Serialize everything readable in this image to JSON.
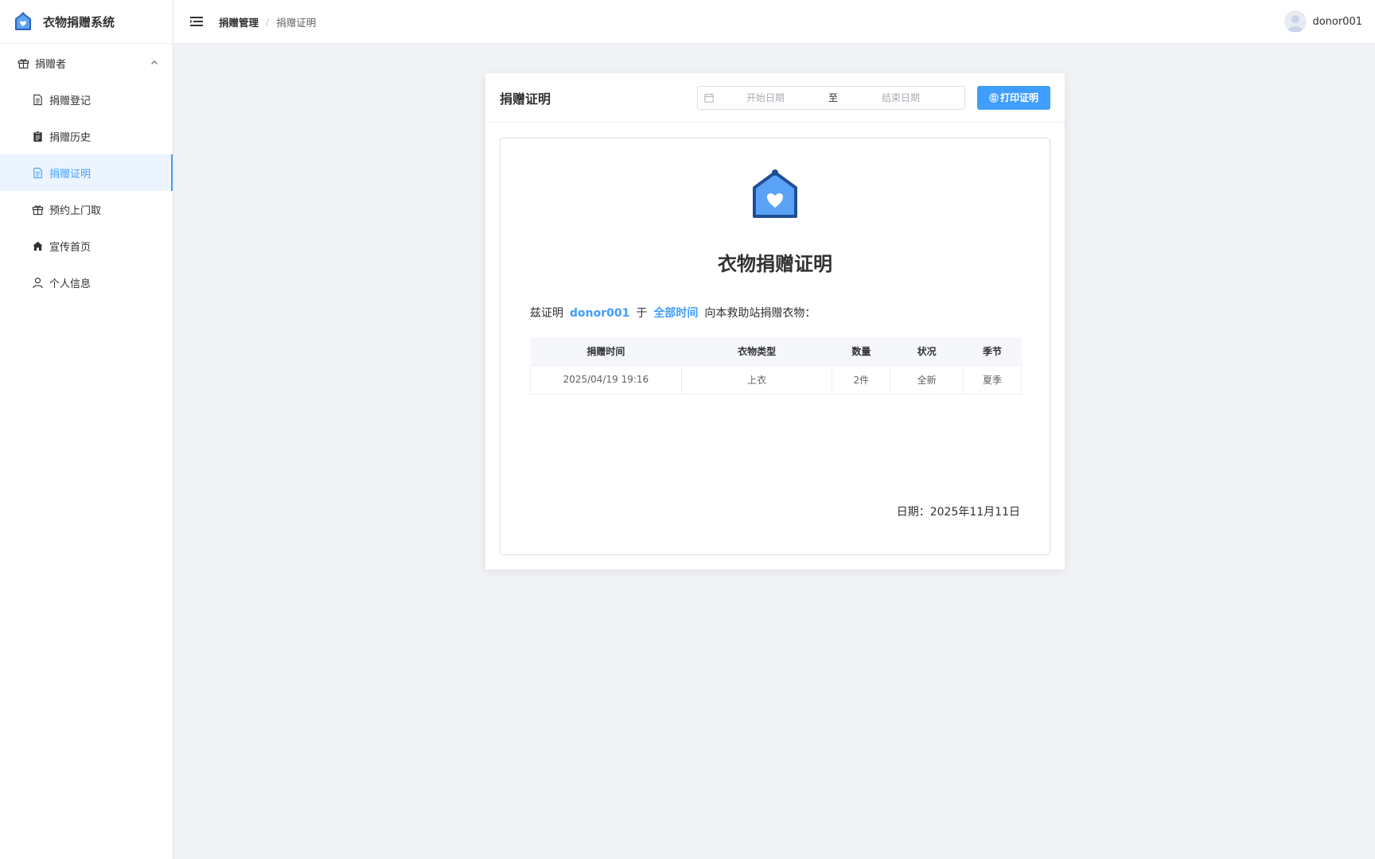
{
  "app": {
    "title": "衣物捐赠系统"
  },
  "sidebar": {
    "group": {
      "label": "捐赠者",
      "icon": "gift-icon"
    },
    "items": [
      {
        "label": "捐赠登记",
        "icon": "document-icon",
        "active": false
      },
      {
        "label": "捐赠历史",
        "icon": "clipboard-icon",
        "active": false
      },
      {
        "label": "捐赠证明",
        "icon": "document-icon",
        "active": true
      },
      {
        "label": "预约上门取",
        "icon": "gift-icon",
        "active": false
      },
      {
        "label": "宣传首页",
        "icon": "home-icon",
        "active": false
      },
      {
        "label": "个人信息",
        "icon": "user-icon",
        "active": false
      }
    ]
  },
  "header": {
    "breadcrumb": [
      "捐赠管理",
      "捐赠证明"
    ],
    "separator": "/",
    "user": "donor001"
  },
  "card": {
    "title": "捐赠证明",
    "date_range": {
      "start_placeholder": "开始日期",
      "separator": "至",
      "end_placeholder": "结束日期"
    },
    "print_button": "打印证明"
  },
  "certificate": {
    "title": "衣物捐赠证明",
    "text_prefix": "兹证明",
    "donor": "donor001",
    "text_mid": "于",
    "period": "全部时间",
    "text_suffix": "向本救助站捐赠衣物：",
    "table": {
      "headers": [
        "捐赠时间",
        "衣物类型",
        "数量",
        "状况",
        "季节"
      ],
      "rows": [
        [
          "2025/04/19 19:16",
          "上衣",
          "2件",
          "全新",
          "夏季"
        ]
      ]
    },
    "date": "日期：2025年11月11日"
  },
  "colors": {
    "accent": "#409eff",
    "active_bg": "#ecf5ff",
    "page_bg": "#f0f2f5",
    "logo_blue": "#3a7bd5"
  }
}
